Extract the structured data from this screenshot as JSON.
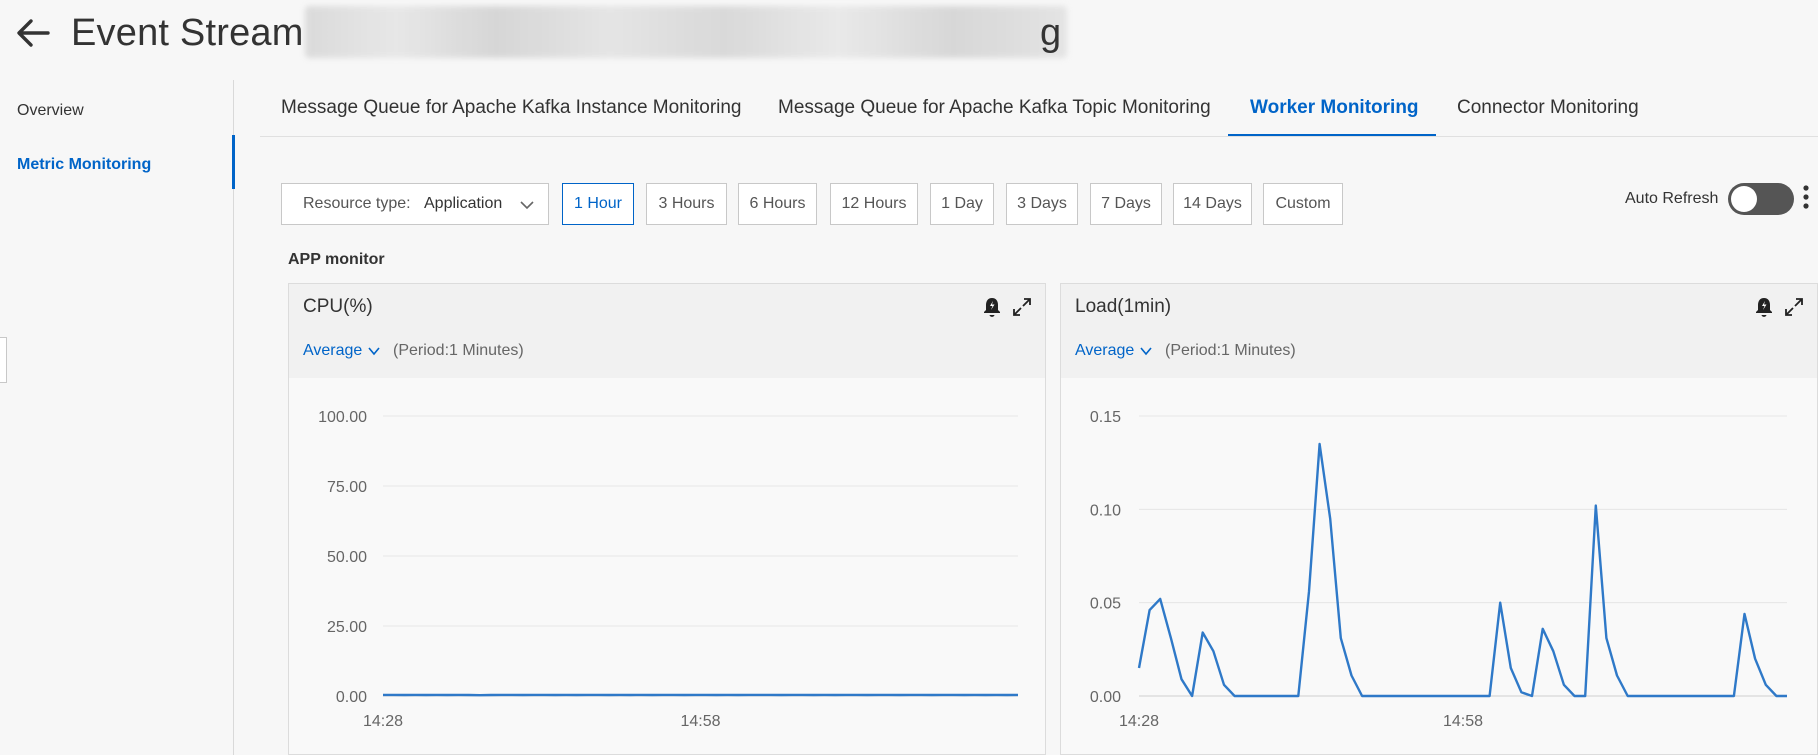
{
  "header": {
    "title": "Event Stream",
    "title_suffix": "g",
    "back_icon": "arrow-left-icon"
  },
  "sidebar": {
    "items": [
      {
        "label": "Overview",
        "active": false
      },
      {
        "label": "Metric Monitoring",
        "active": true
      }
    ]
  },
  "tabs": [
    {
      "label": "Message Queue for Apache Kafka Instance Monitoring",
      "active": false
    },
    {
      "label": "Message Queue for Apache Kafka Topic Monitoring",
      "active": false
    },
    {
      "label": "Worker Monitoring",
      "active": true
    },
    {
      "label": "Connector Monitoring",
      "active": false
    }
  ],
  "toolbar": {
    "resource_type_label": "Resource type:",
    "resource_type_value": "Application",
    "time_ranges": [
      {
        "label": "1 Hour",
        "active": true
      },
      {
        "label": "3 Hours",
        "active": false
      },
      {
        "label": "6 Hours",
        "active": false
      },
      {
        "label": "12 Hours",
        "active": false
      },
      {
        "label": "1 Day",
        "active": false
      },
      {
        "label": "3 Days",
        "active": false
      },
      {
        "label": "7 Days",
        "active": false
      },
      {
        "label": "14 Days",
        "active": false
      },
      {
        "label": "Custom",
        "active": false
      }
    ],
    "auto_refresh_label": "Auto Refresh",
    "auto_refresh_on": false
  },
  "section": {
    "title": "APP monitor"
  },
  "colors": {
    "accent": "#0064c8",
    "series": "#2f79c8"
  },
  "panels": [
    {
      "title": "CPU(%)",
      "aggregation": "Average",
      "period": "(Period:1 Minutes)"
    },
    {
      "title": "Load(1min)",
      "aggregation": "Average",
      "period": "(Period:1 Minutes)"
    }
  ],
  "chart_data": [
    {
      "type": "line",
      "title": "CPU(%)",
      "y_tick_labels": [
        "100.00",
        "75.00",
        "50.00",
        "25.00",
        "0.00"
      ],
      "ylim": [
        0,
        100
      ],
      "x_tick_labels": [
        "14:28",
        "14:58"
      ],
      "grid": true,
      "series": [
        {
          "values": [
            0.4,
            0.4,
            0.35,
            0.4,
            0.35,
            0.4,
            0.35,
            0.4,
            0.35,
            0.3,
            0.35,
            0.4,
            0.4,
            0.35,
            0.4,
            0.4,
            0.35,
            0.4,
            0.35,
            0.4,
            0.4,
            0.35,
            0.4,
            0.35,
            0.4,
            0.35,
            0.4,
            0.4,
            0.35,
            0.4,
            0.4,
            0.35,
            0.4,
            0.35,
            0.4,
            0.4,
            0.4,
            0.35,
            0.4,
            0.4,
            0.35,
            0.4,
            0.35,
            0.4,
            0.4,
            0.35,
            0.4,
            0.4,
            0.35,
            0.4,
            0.4,
            0.35,
            0.4,
            0.4,
            0.35,
            0.4,
            0.35,
            0.4,
            0.35,
            0.4
          ]
        }
      ]
    },
    {
      "type": "line",
      "title": "Load(1min)",
      "y_tick_labels": [
        "0.15",
        "0.10",
        "0.05",
        "0.00"
      ],
      "ylim": [
        0,
        0.15
      ],
      "x_tick_labels": [
        "14:28",
        "14:58"
      ],
      "grid": true,
      "series": [
        {
          "values": [
            0.015,
            0.046,
            0.052,
            0.031,
            0.009,
            0,
            0.034,
            0.024,
            0.006,
            0,
            0,
            0,
            0,
            0,
            0,
            0,
            0.056,
            0.135,
            0.095,
            0.031,
            0.011,
            0,
            0,
            0,
            0,
            0,
            0,
            0,
            0,
            0,
            0,
            0,
            0,
            0,
            0.05,
            0.015,
            0.002,
            0,
            0.036,
            0.024,
            0.006,
            0,
            0,
            0.102,
            0.031,
            0.011,
            0,
            0,
            0,
            0,
            0,
            0,
            0,
            0,
            0,
            0,
            0,
            0.044,
            0.02,
            0.006,
            0,
            0
          ]
        }
      ]
    }
  ]
}
